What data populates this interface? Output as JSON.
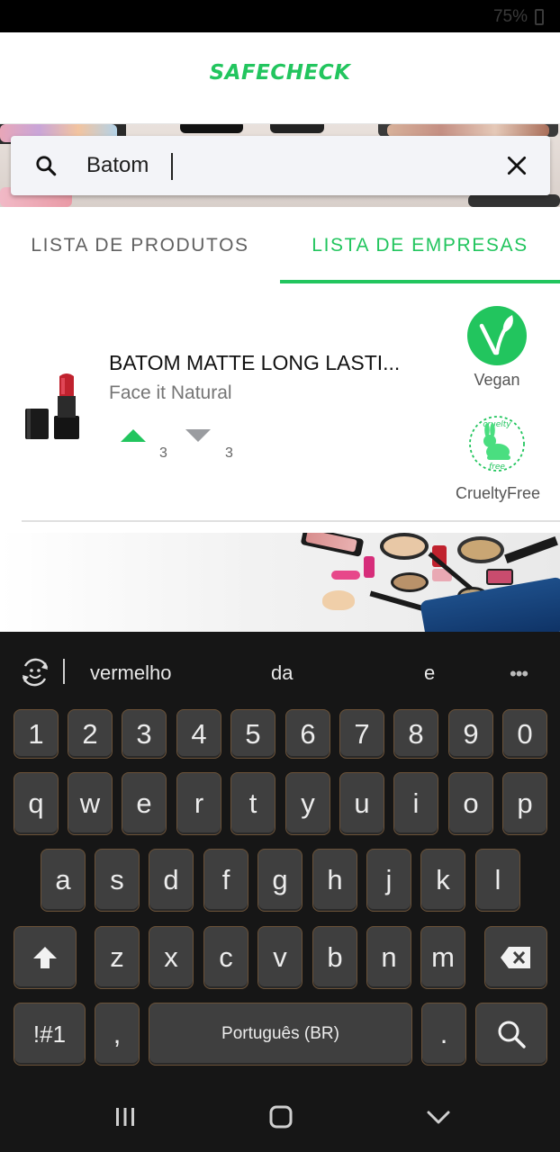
{
  "status_bar": {
    "battery": "75%"
  },
  "header": {
    "logo": "SAFECHECK",
    "brand_color": "#22c55e"
  },
  "search": {
    "value": "Batom",
    "placeholder": ""
  },
  "tabs": [
    {
      "label": "LISTA DE PRODUTOS",
      "active": false
    },
    {
      "label": "LISTA DE EMPRESAS",
      "active": true
    }
  ],
  "product": {
    "name": "BATOM MATTE LONG LASTI...",
    "brand": "Face it Natural",
    "upvotes": "3",
    "downvotes": "3",
    "badges": [
      {
        "label": "Vegan",
        "icon": "vegan-icon"
      },
      {
        "label": "CrueltyFree",
        "icon": "cruelty-free-icon",
        "ring_text": "cruelty",
        "ring_text_bottom": "free"
      }
    ]
  },
  "keyboard": {
    "suggestions": [
      "vermelho",
      "da",
      "e"
    ],
    "row_numbers": [
      "1",
      "2",
      "3",
      "4",
      "5",
      "6",
      "7",
      "8",
      "9",
      "0"
    ],
    "row_top": [
      "q",
      "w",
      "e",
      "r",
      "t",
      "y",
      "u",
      "i",
      "o",
      "p"
    ],
    "row_middle": [
      "a",
      "s",
      "d",
      "f",
      "g",
      "h",
      "j",
      "k",
      "l"
    ],
    "row_bottom": [
      "z",
      "x",
      "c",
      "v",
      "b",
      "n",
      "m"
    ],
    "symbols_label": "!#1",
    "comma_label": ",",
    "space_label": "Português (BR)",
    "period_label": "."
  }
}
